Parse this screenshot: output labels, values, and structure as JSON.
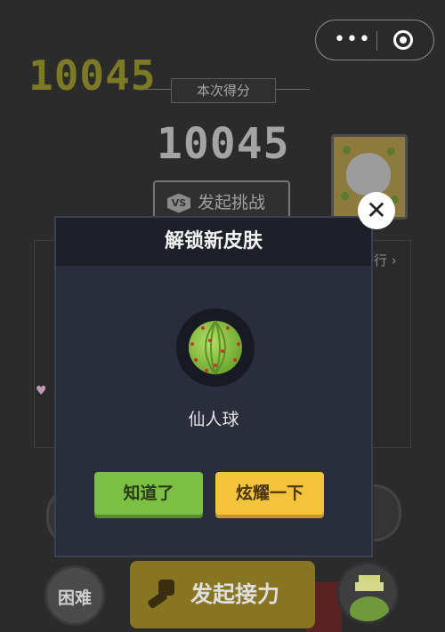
{
  "background": {
    "best_score": "10045",
    "score_label": "本次得分",
    "current_score": "10045",
    "challenge_label": "发起挑战",
    "vs_text": "VS",
    "panel_right_text": "行 ›",
    "difficulty_label": "困难",
    "relay_label": "发起接力"
  },
  "capsule": {
    "more_icon": "more-dots-icon",
    "close_icon": "target-icon"
  },
  "modal": {
    "title": "解锁新皮肤",
    "skin_name": "仙人球",
    "know_button": "知道了",
    "show_off_button": "炫耀一下",
    "close_symbol": "✕"
  },
  "colors": {
    "modal_bg": "#2a2d3b",
    "know_green": "#7bc043",
    "show_yellow": "#f4c33c",
    "cactus_green": "#8ac53f"
  }
}
